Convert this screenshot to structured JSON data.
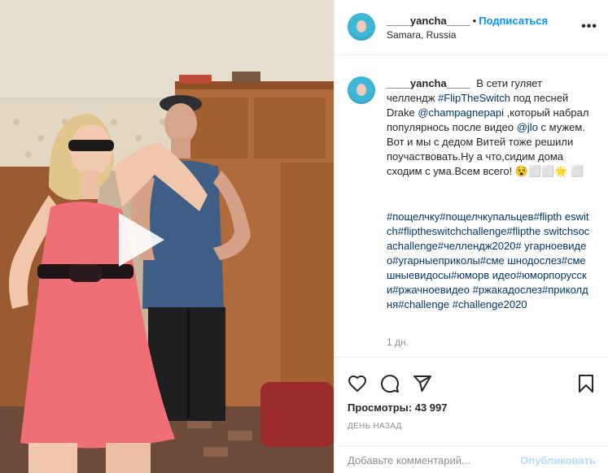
{
  "post": {
    "username": "____yancha____",
    "follow_label": "Подписаться",
    "location": "Samara, Russia",
    "more_icon": "more-horizontal-icon",
    "caption_text": "В сети гуляет челлендж",
    "caption_tag1": "#FlipTheSwitch",
    "caption_text2": "под песней Drake",
    "caption_mention1": "@champagnepapi",
    "caption_text3": ",который набрал популярнось после видео",
    "caption_mention2": "@jlo",
    "caption_text4": "с мужем. Вот и мы с дедом Витей тоже решили поучаствовать.Ну а что,сидим дома сходим с ума.Всем всего! 😵⬜⬜🌟 ⬜",
    "hashtags": "#пощелчку#пощелчкупальцев#flipth eswitch#fliptheswitchchallenge#flipthe switchsocachallenge#челлендж2020# угарноевидео#угарныеприколы#сме шнодослез#смешныевидосы#юморв идео#юморпорусски#ржачноевидео #ржакадослез#приколдня#challenge #challenge2020",
    "time": "1 дн.",
    "views_label": "Просмотры:",
    "views_count": "43 997",
    "date": "День назад"
  },
  "actions": {
    "like_icon": "heart-icon",
    "comment_icon": "comment-icon",
    "share_icon": "share-icon",
    "save_icon": "bookmark-icon"
  },
  "comment_box": {
    "placeholder": "Добавьте комментарий...",
    "publish_label": "Опубликовать"
  },
  "media": {
    "play_icon": "play-icon"
  },
  "colors": {
    "link": "#0095f6",
    "tag": "#00376b",
    "muted": "#8e8e8e",
    "publish_disabled": "#b2dffc"
  }
}
